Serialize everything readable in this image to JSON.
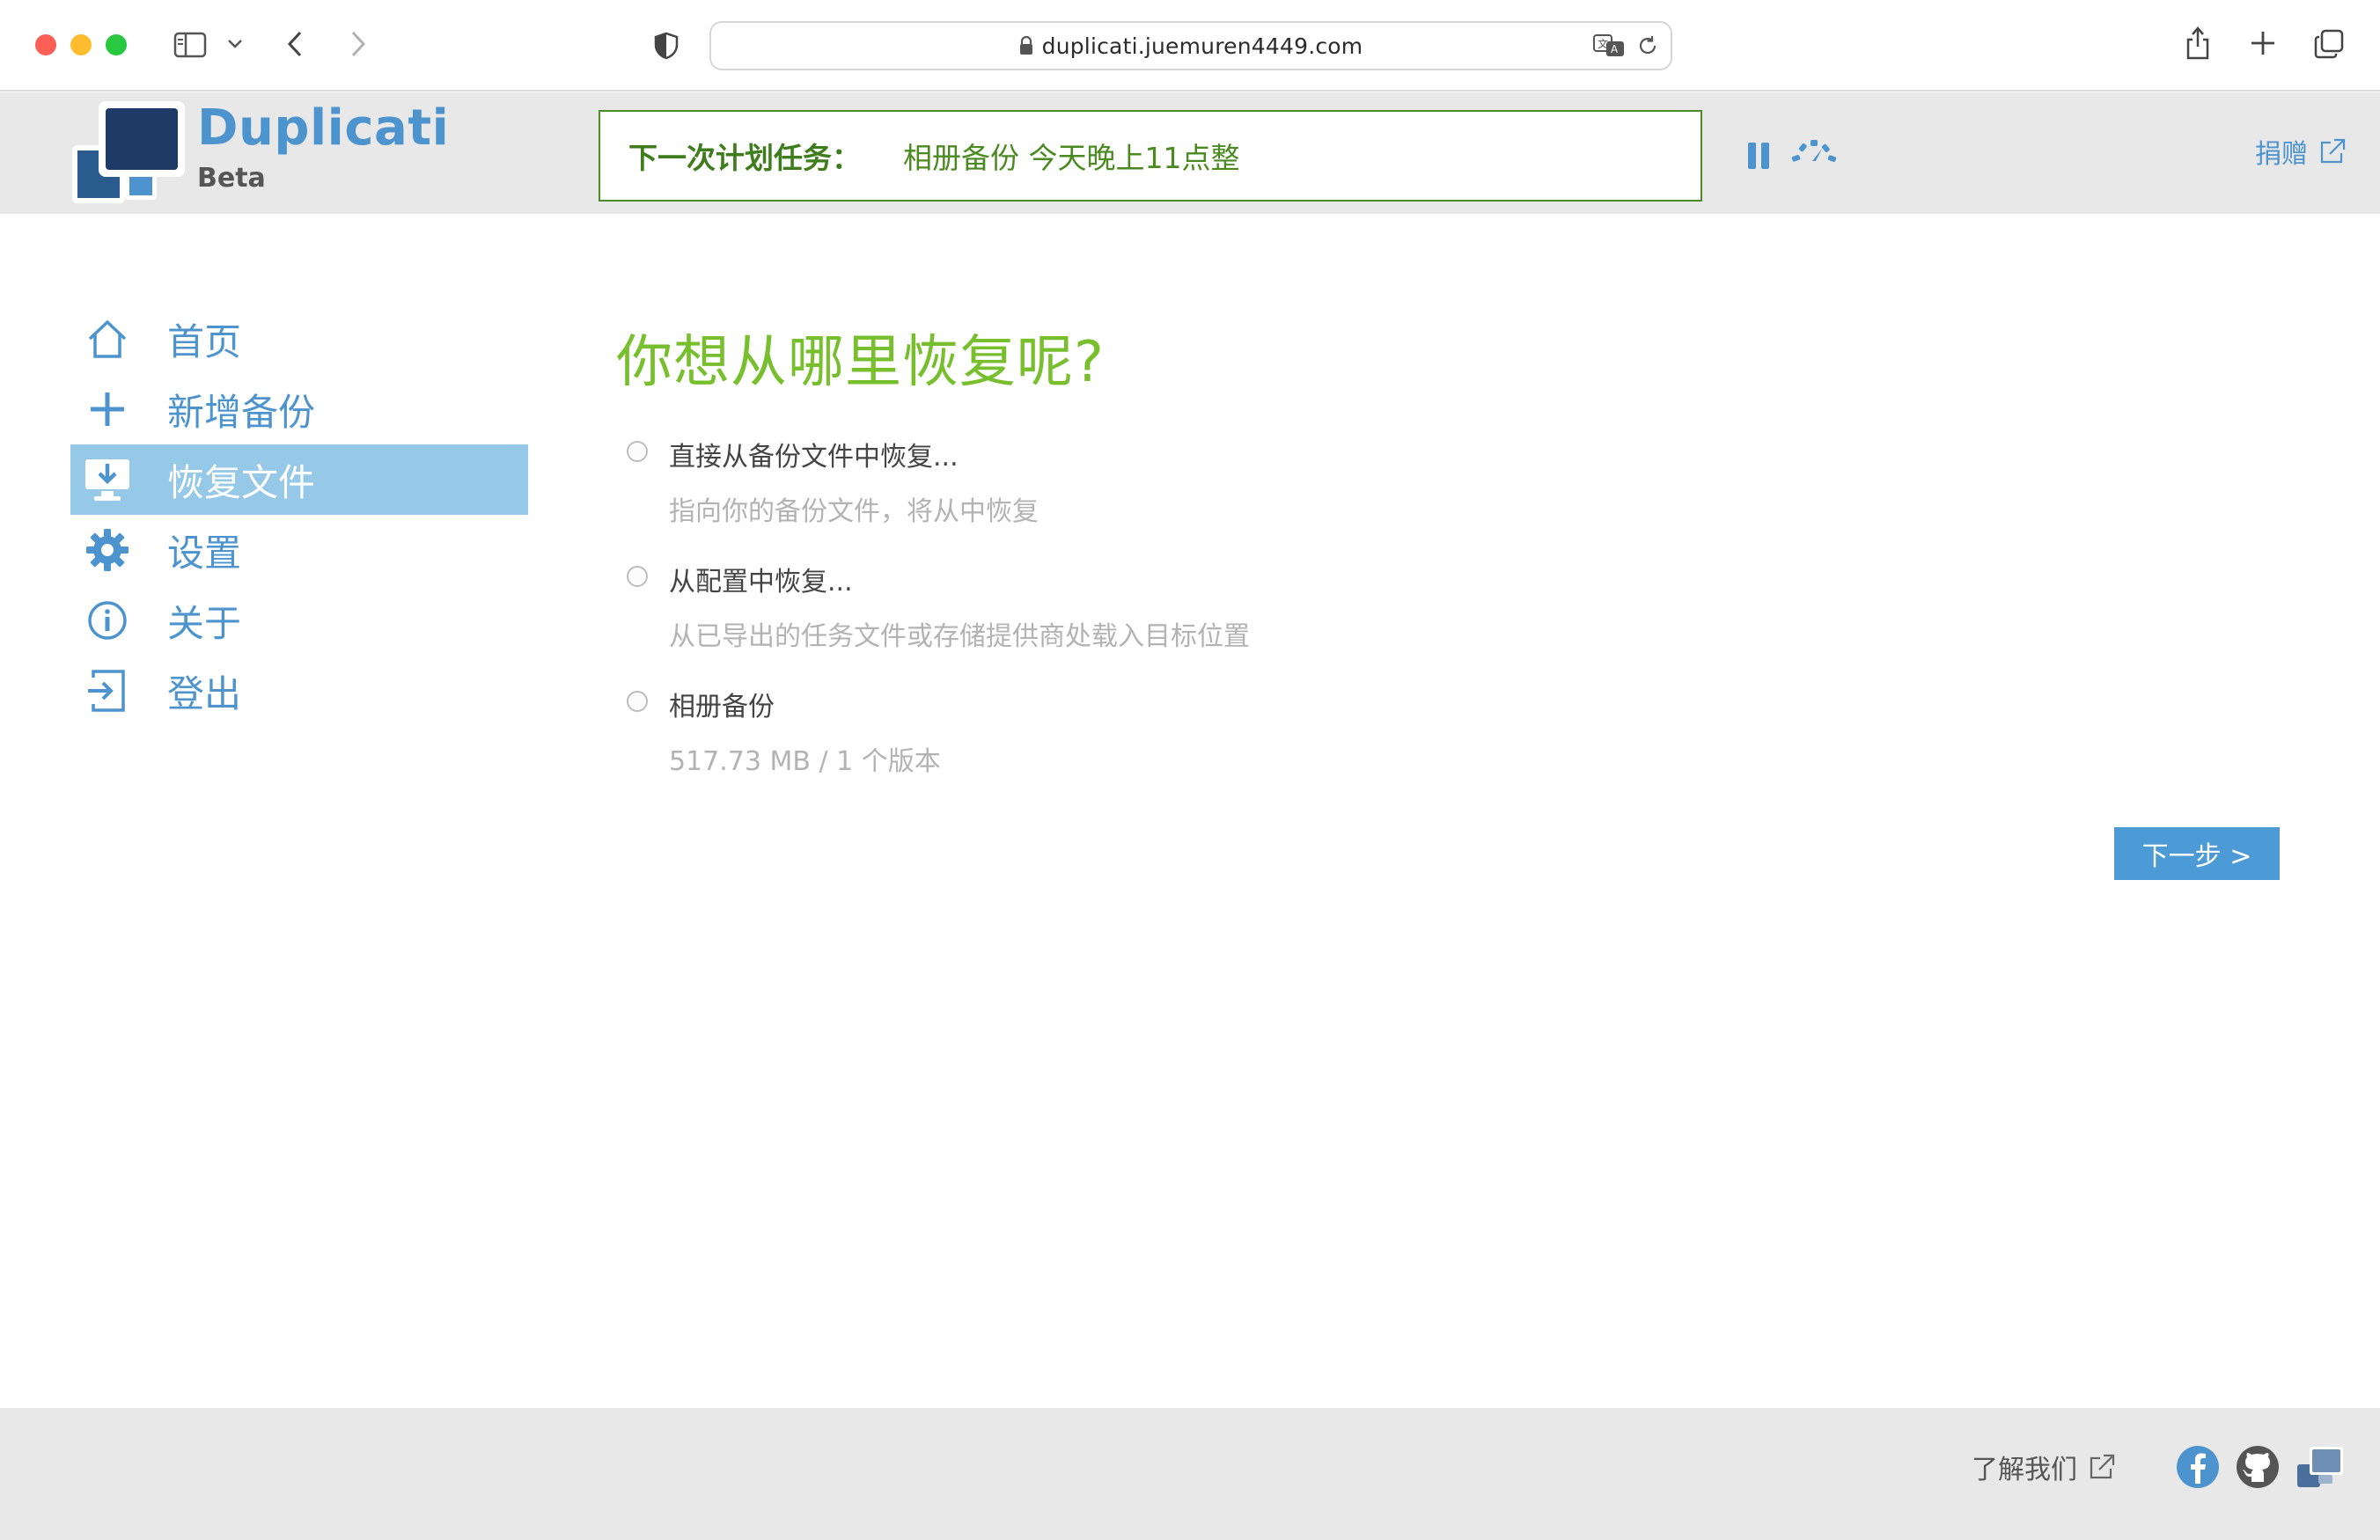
{
  "browser": {
    "url": "duplicati.juemuren4449.com"
  },
  "header": {
    "logo_title": "Duplicati",
    "logo_subtitle": "Beta",
    "schedule_label": "下一次计划任务：",
    "schedule_value": "相册备份 今天晚上11点整",
    "donate_label": "捐赠"
  },
  "sidebar": {
    "items": [
      {
        "label": "首页",
        "icon": "home-icon"
      },
      {
        "label": "新增备份",
        "icon": "plus-icon"
      },
      {
        "label": "恢复文件",
        "icon": "restore-icon",
        "active": true
      },
      {
        "label": "设置",
        "icon": "gear-icon"
      },
      {
        "label": "关于",
        "icon": "info-icon"
      },
      {
        "label": "登出",
        "icon": "logout-icon"
      }
    ]
  },
  "main": {
    "title": "你想从哪里恢复呢?",
    "options": [
      {
        "title": "直接从备份文件中恢复...",
        "description": "指向你的备份文件，将从中恢复"
      },
      {
        "title": "从配置中恢复...",
        "description": "从已导出的任务文件或存储提供商处载入目标位置"
      },
      {
        "title": "相册备份",
        "description": "517.73 MB / 1 个版本"
      }
    ],
    "next_button": "下一步 >"
  },
  "footer": {
    "about_label": "了解我们"
  },
  "colors": {
    "accent_blue": "#4d94cf",
    "title_green": "#77bf2d",
    "schedule_green": "#3f7d1c",
    "active_nav_bg": "#96c8e8",
    "header_bg": "#e8e8e8"
  }
}
